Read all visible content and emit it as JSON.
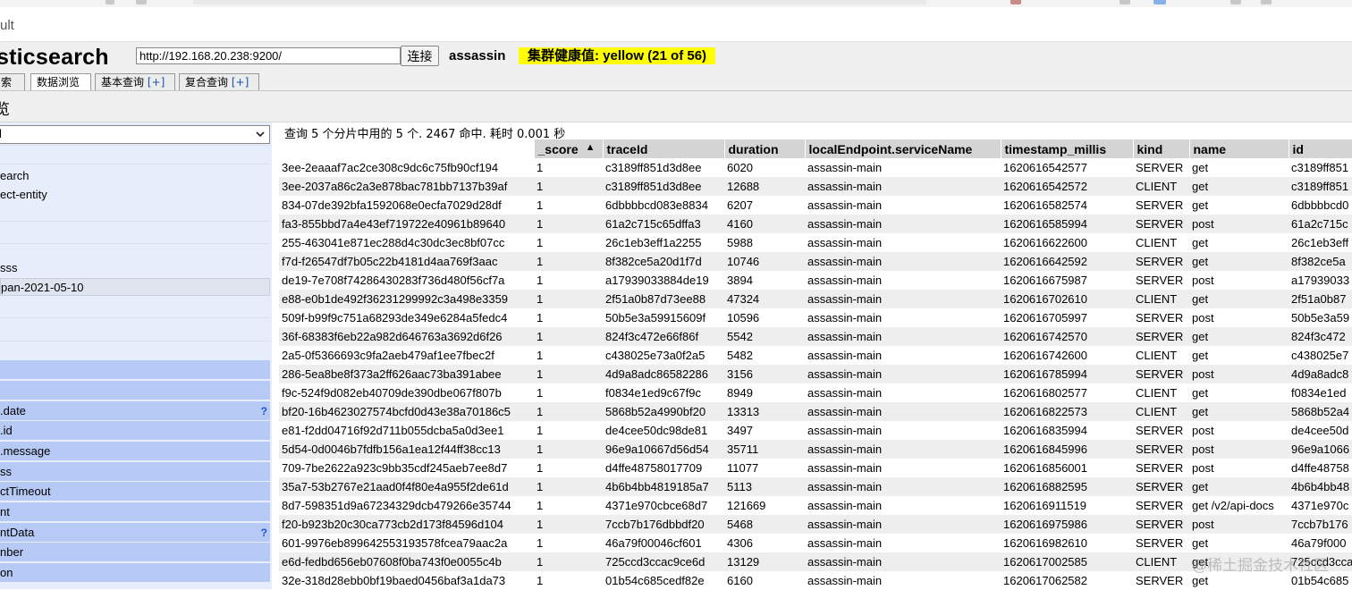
{
  "browser": {
    "tab_title": "ult"
  },
  "header": {
    "app_title": "sticsearch",
    "url_value": "http://192.168.20.238:9200/",
    "connect_label": "连接",
    "cluster_name": "assassin",
    "health": "集群健康值: yellow (21 of 56)",
    "health_color": "#ffff00"
  },
  "tabs": [
    {
      "label": "索引",
      "plus": ""
    },
    {
      "label": "数据浏览",
      "plus": ""
    },
    {
      "label": "基本查询 ",
      "plus": "[+]"
    },
    {
      "label": "复合查询 ",
      "plus": "[+]"
    }
  ],
  "section": {
    "title": "览"
  },
  "sidebar": {
    "select_value": "l",
    "indices": [
      "earch",
      "ect-entity",
      "",
      "",
      "sss",
      "pan-2021-05-10"
    ],
    "fields": [
      {
        "label": "",
        "help": ""
      },
      {
        "label": "",
        "help": ""
      },
      {
        "label": ".date",
        "help": "?"
      },
      {
        "label": ".id",
        "help": ""
      },
      {
        "label": ".message",
        "help": ""
      },
      {
        "label": "ss",
        "help": ""
      },
      {
        "label": "ctTimeout",
        "help": ""
      },
      {
        "label": "nt",
        "help": ""
      },
      {
        "label": "ntData",
        "help": "?"
      },
      {
        "label": "nber",
        "help": ""
      },
      {
        "label": "on",
        "help": ""
      }
    ]
  },
  "main": {
    "query_info": "查询 5 个分片中用的 5 个. 2467 命中. 耗时 0.001 秒",
    "columns": [
      "",
      "_score",
      "traceId",
      "duration",
      "localEndpoint.serviceName",
      "timestamp_millis",
      "kind",
      "name",
      "id"
    ],
    "sort_indicator": "▲",
    "rows": [
      [
        "3ee-2eaaaf7ac2ce308c9dc6c75fb90cf194",
        "1",
        "c3189ff851d3d8ee",
        "6020",
        "assassin-main",
        "1620616542577",
        "SERVER",
        "get",
        "c3189ff851"
      ],
      [
        "3ee-2037a86c2a3e878bac781bb7137b39af",
        "1",
        "c3189ff851d3d8ee",
        "12688",
        "assassin-main",
        "1620616542572",
        "CLIENT",
        "get",
        "c3189ff851"
      ],
      [
        "834-07de392bfa1592068e0ecfa7029d28df",
        "1",
        "6dbbbbcd083e8834",
        "6207",
        "assassin-main",
        "1620616582574",
        "SERVER",
        "get",
        "6dbbbbcd0"
      ],
      [
        "fa3-855bbd7a4e43ef719722e40961b89640",
        "1",
        "61a2c715c65dffa3",
        "4160",
        "assassin-main",
        "1620616585994",
        "SERVER",
        "post",
        "61a2c715c"
      ],
      [
        "255-463041e871ec288d4c30dc3ec8bf07cc",
        "1",
        "26c1eb3eff1a2255",
        "5988",
        "assassin-main",
        "1620616622600",
        "CLIENT",
        "get",
        "26c1eb3eff"
      ],
      [
        "f7d-f26547df7b05c22b4181d4aa769f3aac",
        "1",
        "8f382ce5a20d1f7d",
        "10746",
        "assassin-main",
        "1620616642592",
        "SERVER",
        "get",
        "8f382ce5a"
      ],
      [
        "de19-7e708f74286430283f736d480f56cf7a",
        "1",
        "a17939033884de19",
        "3894",
        "assassin-main",
        "1620616675987",
        "SERVER",
        "post",
        "a17939033"
      ],
      [
        "e88-e0b1de492f36231299992c3a498e3359",
        "1",
        "2f51a0b87d73ee88",
        "47324",
        "assassin-main",
        "1620616702610",
        "CLIENT",
        "get",
        "2f51a0b87"
      ],
      [
        "509f-b99f9c751a68293de349e6284a5fedc4",
        "1",
        "50b5e3a59915609f",
        "10596",
        "assassin-main",
        "1620616705997",
        "SERVER",
        "post",
        "50b5e3a59"
      ],
      [
        "36f-68383f6eb22a982d646763a3692d6f26",
        "1",
        "824f3c472e66f86f",
        "5542",
        "assassin-main",
        "1620616742570",
        "SERVER",
        "get",
        "824f3c472"
      ],
      [
        "2a5-0f5366693c9fa2aeb479af1ee7fbec2f",
        "1",
        "c438025e73a0f2a5",
        "5482",
        "assassin-main",
        "1620616742600",
        "CLIENT",
        "get",
        "c438025e7"
      ],
      [
        "286-5ea8be8f373a2ff626aac73ba391abee",
        "1",
        "4d9a8adc86582286",
        "3156",
        "assassin-main",
        "1620616785994",
        "SERVER",
        "post",
        "4d9a8adc8"
      ],
      [
        "f9c-524f9d082eb40709de390dbe067f807b",
        "1",
        "f0834e1ed9c67f9c",
        "8949",
        "assassin-main",
        "1620616802577",
        "CLIENT",
        "get",
        "f0834e1ed"
      ],
      [
        "bf20-16b4623027574bcfd0d43e38a70186c5",
        "1",
        "5868b52a4990bf20",
        "13313",
        "assassin-main",
        "1620616822573",
        "CLIENT",
        "get",
        "5868b52a4"
      ],
      [
        "e81-f2dd04716f92d711b055dcba5a0d3ee1",
        "1",
        "de4cee50dc98de81",
        "3497",
        "assassin-main",
        "1620616835994",
        "SERVER",
        "post",
        "de4cee50d"
      ],
      [
        "5d54-0d0046b7fdfb156a1ea12f44ff38cc13",
        "1",
        "96e9a10667d56d54",
        "35711",
        "assassin-main",
        "1620616845996",
        "SERVER",
        "post",
        "96e9a1066"
      ],
      [
        "709-7be2622a923c9bb35cdf245aeb7ee8d7",
        "1",
        "d4ffe48758017709",
        "11077",
        "assassin-main",
        "1620616856001",
        "SERVER",
        "post",
        "d4ffe48758"
      ],
      [
        "35a7-53b2767e21aad0f4f80e4a955f2de61d",
        "1",
        "4b6b4bb4819185a7",
        "5113",
        "assassin-main",
        "1620616882595",
        "SERVER",
        "get",
        "4b6b4bb48"
      ],
      [
        "8d7-598351d9a67234329dcb479266e35744",
        "1",
        "4371e970cbce68d7",
        "121669",
        "assassin-main",
        "1620616911519",
        "SERVER",
        "get /v2/api-docs",
        "4371e970c"
      ],
      [
        "f20-b923b20c30ca773cb2d173f84596d104",
        "1",
        "7ccb7b176dbbdf20",
        "5468",
        "assassin-main",
        "1620616975986",
        "SERVER",
        "post",
        "7ccb7b176"
      ],
      [
        "601-9976eb899642553193578fcea79aac2a",
        "1",
        "46a79f00046cf601",
        "4306",
        "assassin-main",
        "1620616982610",
        "SERVER",
        "get",
        "46a79f000"
      ],
      [
        "e6d-fedbd656eb07608f0ba743f0e0055c4b",
        "1",
        "725ccd3ccac9ce6d",
        "13129",
        "assassin-main",
        "1620617002585",
        "CLIENT",
        "get",
        "725ccd3cca"
      ],
      [
        "32e-318d28ebb0bf19baed0456baf3a1da73",
        "1",
        "01b54c685cedf82e",
        "6160",
        "assassin-main",
        "1620617062582",
        "SERVER",
        "get",
        "01b54c685"
      ]
    ]
  },
  "watermark": "@稀土掘金技术社区"
}
